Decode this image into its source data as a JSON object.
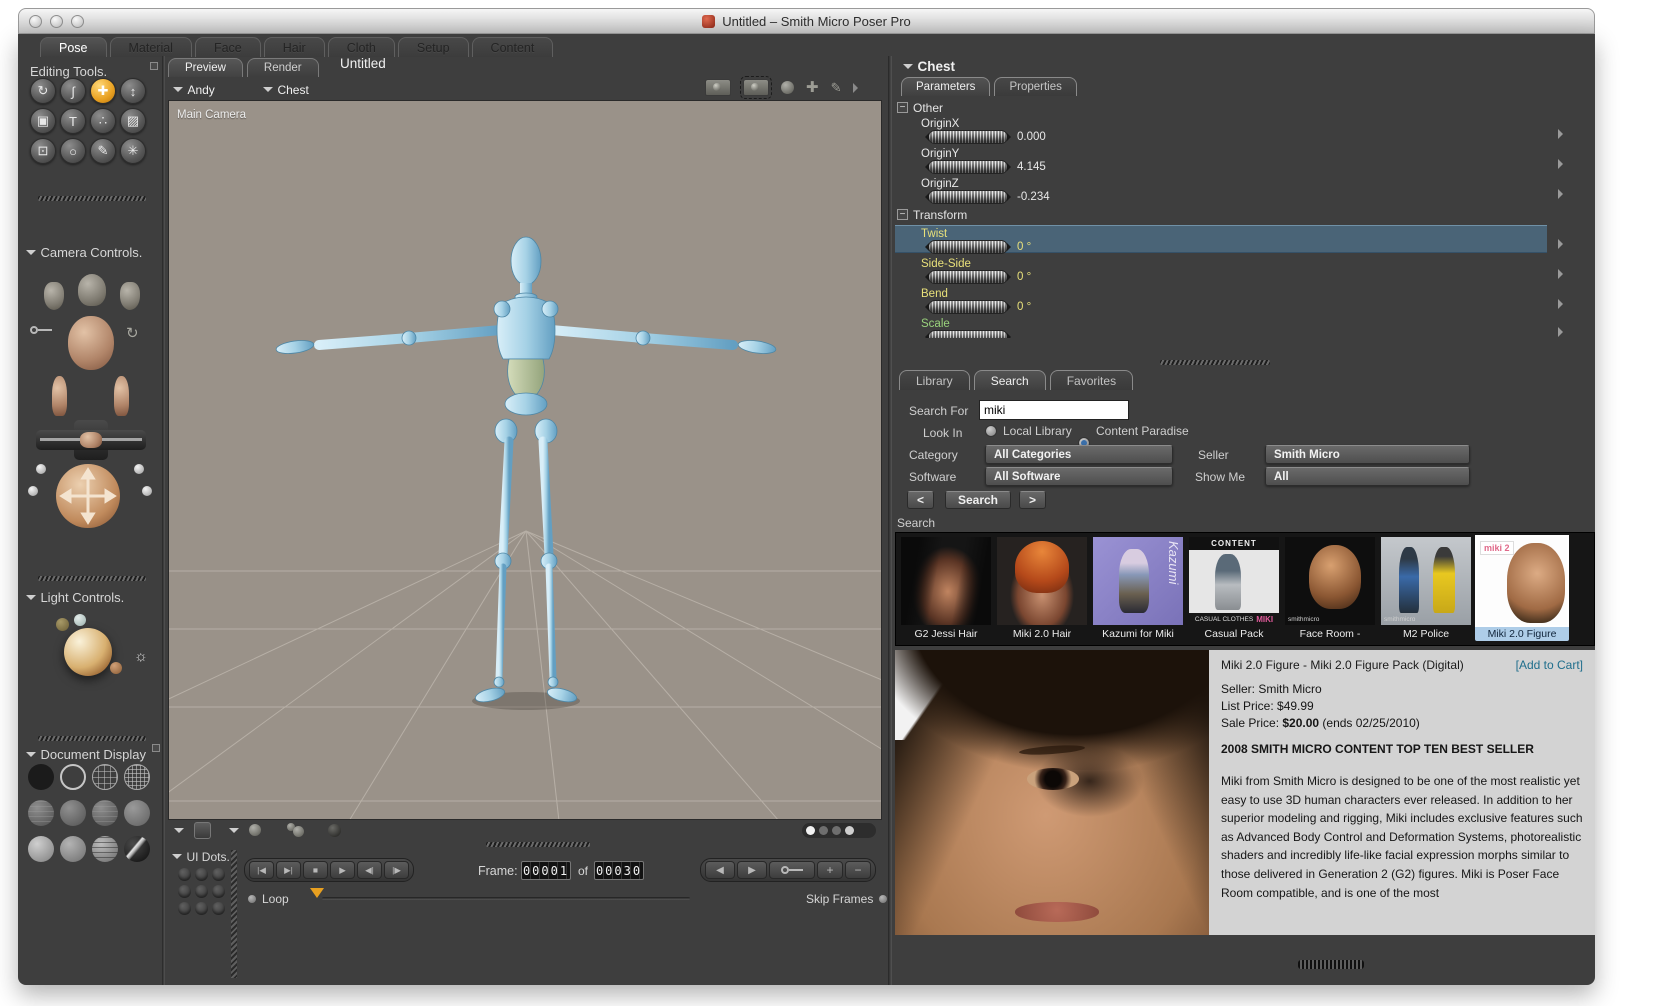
{
  "titlebar": {
    "title": "Untitled – Smith Micro Poser Pro"
  },
  "app_tabs": [
    {
      "label": "Pose",
      "active": true
    },
    {
      "label": "Material"
    },
    {
      "label": "Face"
    },
    {
      "label": "Hair"
    },
    {
      "label": "Cloth"
    },
    {
      "label": "Setup"
    },
    {
      "label": "Content"
    }
  ],
  "sidebar": {
    "editing_tools": {
      "title": "Editing Tools.",
      "tools": [
        {
          "name": "rotate-tool",
          "glyph": "↻"
        },
        {
          "name": "twist-tool",
          "glyph": "∫"
        },
        {
          "name": "translate-pull-tool",
          "glyph": "✚",
          "active": true
        },
        {
          "name": "translate-in-out-tool",
          "glyph": "↕"
        },
        {
          "name": "scale-tool",
          "glyph": "▣"
        },
        {
          "name": "taper-tool",
          "glyph": "T"
        },
        {
          "name": "chain-break-tool",
          "glyph": "∴"
        },
        {
          "name": "grouping-tool",
          "glyph": "▨"
        },
        {
          "name": "direct-manipulation-tool",
          "glyph": "⊡"
        },
        {
          "name": "view-magnifier-tool",
          "glyph": "○"
        },
        {
          "name": "color-tool",
          "glyph": "✎"
        },
        {
          "name": "morphing-tool",
          "glyph": "✳"
        }
      ]
    },
    "camera_controls": {
      "title": "Camera Controls."
    },
    "light_controls": {
      "title": "Light Controls."
    },
    "document_display": {
      "title": "Document Display",
      "styles": [
        "silhouette",
        "outline",
        "wireframe",
        "hidden-line",
        "lit-wireframe",
        "flat-shaded",
        "flat-lined",
        "cartoon",
        "smooth-shaded",
        "smooth-lined",
        "texture-shaded",
        "shadow-preview"
      ]
    }
  },
  "document": {
    "tabs": {
      "preview": "Preview",
      "render": "Render"
    },
    "title": "Untitled",
    "figure_menu": "Andy",
    "actor_menu": "Chest",
    "camera_label": "Main Camera"
  },
  "parameters_panel": {
    "actor": "Chest",
    "tabs": {
      "parameters": "Parameters",
      "properties": "Properties"
    },
    "groups": [
      {
        "name": "Other",
        "params": [
          {
            "label": "OriginX",
            "value": "0.000"
          },
          {
            "label": "OriginY",
            "value": "4.145"
          },
          {
            "label": "OriginZ",
            "value": "-0.234"
          }
        ]
      },
      {
        "name": "Transform",
        "params": [
          {
            "label": "Twist",
            "value": "0 °",
            "selected": true
          },
          {
            "label": "Side-Side",
            "value": "0 °"
          },
          {
            "label": "Bend",
            "value": "0 °"
          },
          {
            "label": "Scale",
            "value": ""
          }
        ]
      }
    ]
  },
  "library_panel": {
    "tabs": {
      "library": "Library",
      "search": "Search",
      "favorites": "Favorites"
    },
    "form": {
      "search_for_label": "Search For",
      "search_value": "miki",
      "look_in_label": "Look In",
      "radio_local": "Local Library",
      "radio_paradise": "Content Paradise",
      "category_label": "Category",
      "category_value": "All Categories",
      "seller_label": "Seller",
      "seller_value": "Smith Micro",
      "software_label": "Software",
      "software_value": "All Software",
      "show_me_label": "Show Me",
      "show_me_value": "All",
      "prev_label": "<",
      "search_button": "Search",
      "next_label": ">"
    },
    "results_label": "Search",
    "results": [
      {
        "label": "G2 Jessi Hair"
      },
      {
        "label": "Miki 2.0 Hair"
      },
      {
        "label": "Kazumi for Miki",
        "overlay": "Kazumi"
      },
      {
        "label": "Casual Pack",
        "overlay_top": "CONTENT",
        "overlay_bottom": "CASUAL CLOTHES",
        "overlay_brand": "MIKI"
      },
      {
        "label": "Face Room -",
        "overlay": "smithmicro"
      },
      {
        "label": "M2 Police",
        "overlay": "smithmicro"
      },
      {
        "label": "Miki 2.0 Figure",
        "overlay": "miki 2",
        "selected": true
      }
    ],
    "detail": {
      "title": "Miki 2.0 Figure - Miki 2.0 Figure Pack (Digital)",
      "add_to_cart": "[Add to Cart]",
      "seller": "Seller: Smith Micro",
      "list_price": "List Price: $49.99",
      "sale_price_label": "Sale Price: ",
      "sale_price_value": "$20.00",
      "sale_price_ends": " (ends 02/25/2010)",
      "banner": "2008 SMITH MICRO CONTENT TOP TEN BEST SELLER",
      "description": "Miki from Smith Micro is designed to be one of the most realistic yet easy to use 3D human characters ever released. In addition to her superior modeling and rigging, Miki includes exclusive features such as Advanced Body Control and Deformation Systems, photorealistic shaders and incredibly life-like facial expression morphs similar to those delivered in Generation 2 (G2) figures. Miki is Poser Face Room compatible, and is one of the most"
    }
  },
  "animation": {
    "ui_dots_label": "UI Dots.",
    "frame_label": "Frame:",
    "frame_current": "00001",
    "of_label": "of",
    "frame_total": "00030",
    "loop_label": "Loop",
    "skip_frames_label": "Skip Frames"
  },
  "colors": {
    "accent_orange": "#e8a020",
    "selected_row_blue": "#54a4c6",
    "selected_thumb_blue": "#aecde8",
    "add_to_cart_teal": "#1f6e8c",
    "param_yellow": "#e8e07a",
    "param_green": "#9ad27c",
    "viewport_gray": "#9a9289"
  }
}
